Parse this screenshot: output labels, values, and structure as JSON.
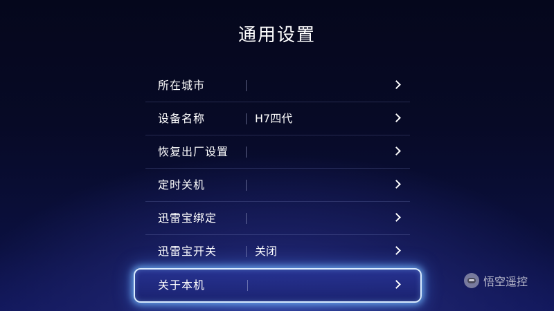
{
  "page": {
    "title": "通用设置"
  },
  "menu": {
    "items": [
      {
        "label": "所在城市",
        "value": ""
      },
      {
        "label": "设备名称",
        "value": "H7四代"
      },
      {
        "label": "恢复出厂设置",
        "value": ""
      },
      {
        "label": "定时关机",
        "value": ""
      },
      {
        "label": "迅雷宝绑定",
        "value": ""
      },
      {
        "label": "迅雷宝开关",
        "value": "关闭"
      },
      {
        "label": "关于本机",
        "value": ""
      }
    ],
    "focused_index": 6
  },
  "watermark": {
    "text": "悟空遥控"
  },
  "colors": {
    "background_top": "#05071c",
    "background_bottom": "#10165a",
    "focus_border": "#d9ecff",
    "focus_glow": "#78beff",
    "text": "#ffffff"
  },
  "icons": {
    "row_arrow": "chevron-right-icon",
    "watermark_logo": "wukong-logo-icon"
  }
}
